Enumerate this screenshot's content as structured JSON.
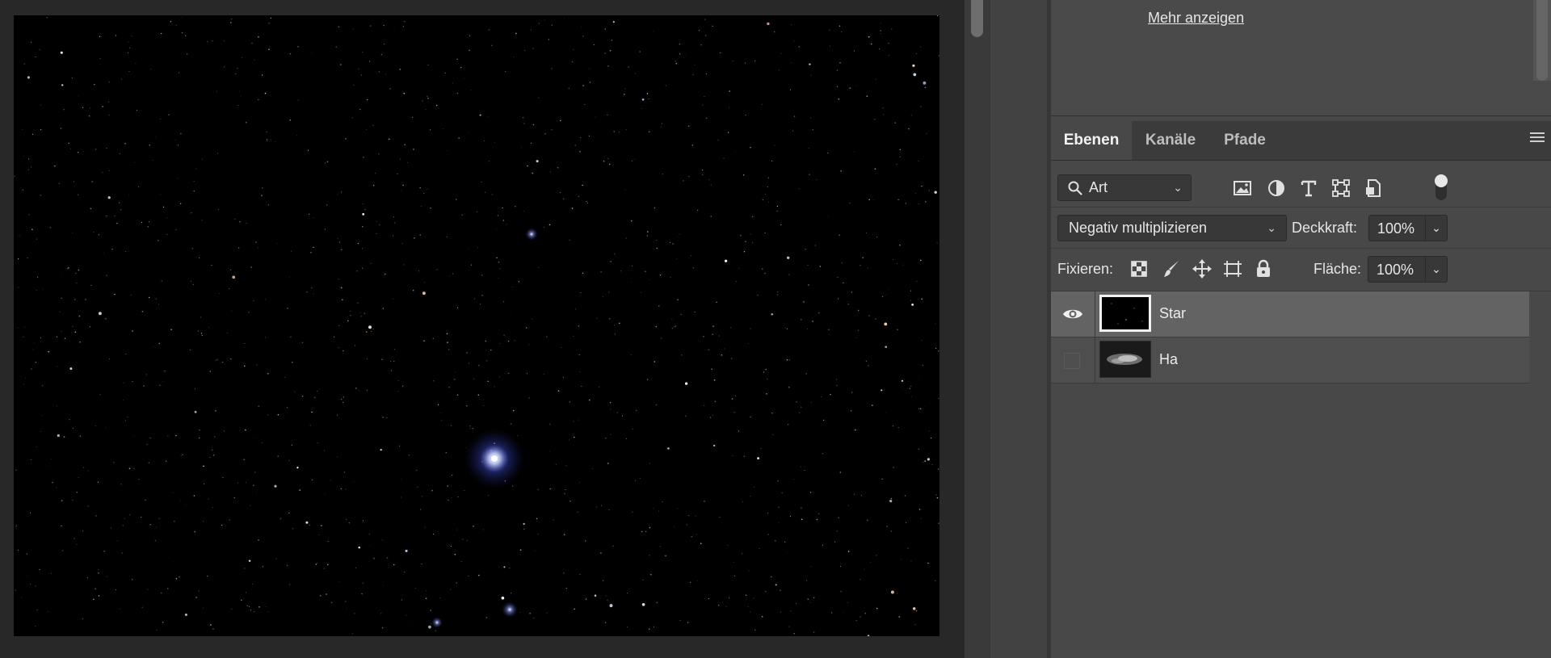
{
  "info_panel": {
    "more_link": "Mehr anzeigen"
  },
  "tabs": [
    {
      "label": "Ebenen",
      "active": true
    },
    {
      "label": "Kanäle",
      "active": false
    },
    {
      "label": "Pfade",
      "active": false
    }
  ],
  "filter": {
    "kind_label": "Art",
    "icons": [
      "image-filter-icon",
      "adjustment-filter-icon",
      "type-filter-icon",
      "shape-filter-icon",
      "smart-object-filter-icon"
    ]
  },
  "blend": {
    "mode": "Negativ multiplizieren",
    "opacity_label": "Deckkraft:",
    "opacity_value": "100%"
  },
  "lock": {
    "label": "Fixieren:",
    "fill_label": "Fläche:",
    "fill_value": "100%"
  },
  "layers": [
    {
      "name": "Star",
      "visible": true,
      "selected": true
    },
    {
      "name": "Ha",
      "visible": false,
      "selected": false
    }
  ],
  "colors": {
    "panel_bg": "#484848",
    "selected_row": "#636363",
    "canvas_bg": "#000000"
  }
}
